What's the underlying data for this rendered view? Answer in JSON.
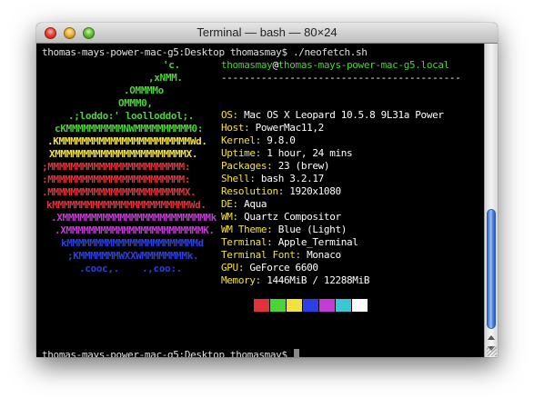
{
  "window": {
    "title": "Terminal — bash — 80×24"
  },
  "terminal": {
    "prompt_line": "thomas-mays-power-mac-g5:Desktop thomasmay$ ./neofetch.sh",
    "user_host_user": "thomasmay",
    "user_host_at": "@",
    "user_host_host": "thomas-mays-power-mac-g5.local",
    "separator": "------------------------------------------",
    "logo_lines": [
      {
        "text": "'c.",
        "color": "#4ad436"
      },
      {
        "text": ",xNMM.",
        "color": "#4ad436"
      },
      {
        "text": ".OMMMMo",
        "color": "#4ad436"
      },
      {
        "text": "OMMM0,",
        "color": "#4ad436"
      },
      {
        "text": ".;loddo:' loolloddol;.",
        "color": "#4ad436"
      },
      {
        "text": "cKMMMMMMMMMMNWMMMMMMMMMM0:",
        "color": "#4ad436"
      },
      {
        "text": ".KMMMMMMMMMMMMMMMMMMMMMMMWd.",
        "color": "#f2e23a"
      },
      {
        "text": "XMMMMMMMMMMMMMMMMMMMMMMMX.",
        "color": "#f2e23a"
      },
      {
        "text": ";MMMMMMMMMMMMMMMMMMMMMMMM:",
        "color": "#e0343a"
      },
      {
        "text": ":MMMMMMMMMMMMMMMMMMMMMMMM:",
        "color": "#e0343a"
      },
      {
        "text": ".MMMMMMMMMMMMMMMMMMMMMMMMX.",
        "color": "#e0343a"
      },
      {
        "text": "kMMMMMMMMMMMMMMMMMMMMMMMMWd.",
        "color": "#e0343a"
      },
      {
        "text": ".XMMMMMMMMMMMMMMMMMMMMMMMMMMk",
        "color": "#c43bd6"
      },
      {
        "text": ".XMMMMMMMMMMMMMMMMMMMMMMMMK.",
        "color": "#c43bd6"
      },
      {
        "text": "kMMMMMMMMMMMMMMMMMMMMMMMd",
        "color": "#2c3fe0"
      },
      {
        "text": ";KMMMMMMMWXXWMMMMMMMMk.",
        "color": "#2c3fe0"
      },
      {
        "text": ".cooc,.    .,coo:.",
        "color": "#2c3fe0"
      }
    ],
    "info": [
      {
        "key": "OS:",
        "value": "Mac OS X Leopard 10.5.8 9L31a Power"
      },
      {
        "key": "Host:",
        "value": "PowerMac11,2"
      },
      {
        "key": "Kernel:",
        "value": "9.8.0"
      },
      {
        "key": "Uptime:",
        "value": "1 hour, 24 mins"
      },
      {
        "key": "Packages:",
        "value": "23 (brew)"
      },
      {
        "key": "Shell:",
        "value": "bash 3.2.17"
      },
      {
        "key": "Resolution:",
        "value": "1920x1080"
      },
      {
        "key": "DE:",
        "value": "Aqua"
      },
      {
        "key": "WM:",
        "value": "Quartz Compositor"
      },
      {
        "key": "WM Theme:",
        "value": "Blue (Light)"
      },
      {
        "key": "Terminal:",
        "value": "Apple_Terminal"
      },
      {
        "key": "Terminal Font:",
        "value": "Monaco"
      },
      {
        "key": "GPU:",
        "value": "GeForce 6600"
      },
      {
        "key": "Memory:",
        "value": "1446MiB / 12288MiB"
      }
    ],
    "color_blocks": [
      "#000000",
      "#e0343a",
      "#4ad436",
      "#f2e23a",
      "#2c3fe0",
      "#c43bd6",
      "#39c6d6",
      "#ffffff"
    ],
    "final_prompt": "thomas-mays-power-mac-g5:Desktop thomasmay$"
  }
}
